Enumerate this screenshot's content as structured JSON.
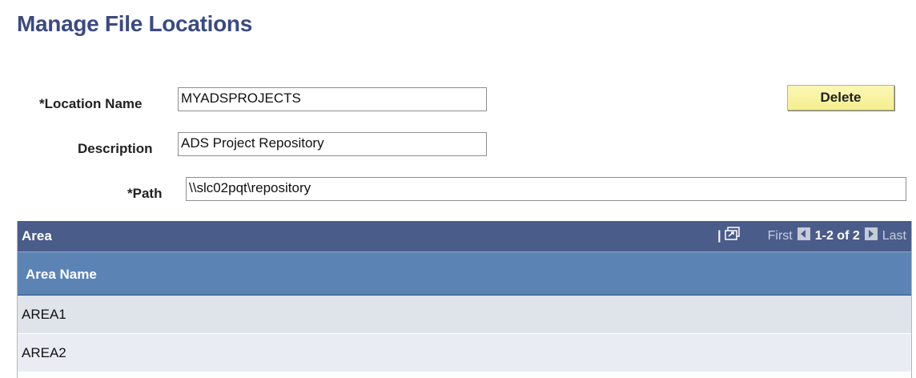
{
  "page": {
    "title": "Manage File Locations"
  },
  "form": {
    "location_name": {
      "label": "*Location Name",
      "value": "MYADSPROJECTS"
    },
    "description": {
      "label": "Description",
      "value": "ADS Project Repository"
    },
    "path": {
      "label": "*Path",
      "value": "\\\\slc02pqt\\repository"
    }
  },
  "toolbar": {
    "delete_label": "Delete"
  },
  "area_grid": {
    "title": "Area",
    "separator": "|",
    "view_all_icon": "view-all-icon",
    "first_label": "First",
    "page_count": "1-2 of 2",
    "last_label": "Last",
    "column_header": "Area Name",
    "rows": [
      {
        "area_name": "AREA1"
      },
      {
        "area_name": "AREA2"
      }
    ]
  },
  "colors": {
    "title": "#3b4a82",
    "grid_header": "#4a5c8a",
    "column_header": "#5b84b5",
    "delete_button": "#f8f3a3"
  }
}
